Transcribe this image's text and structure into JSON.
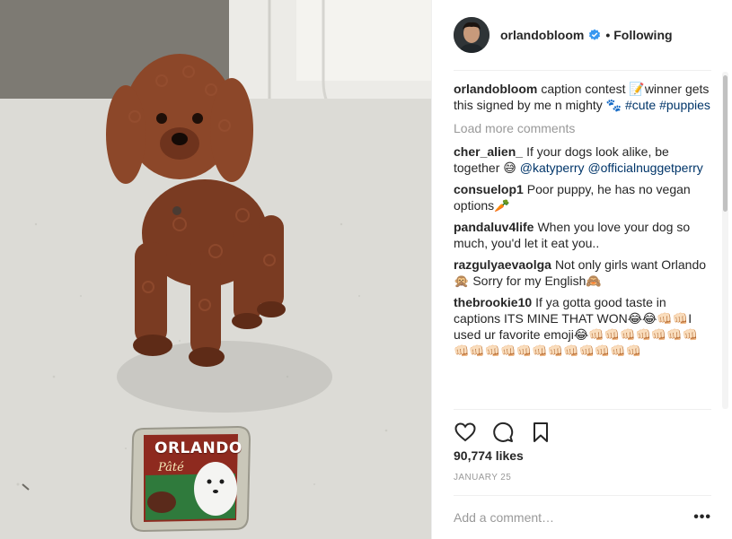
{
  "photo": {
    "can_brand": "ORLANDO",
    "can_sub": "Pâté"
  },
  "header": {
    "username": "orlandobloom",
    "separator": "•",
    "follow_status": "Following"
  },
  "caption": {
    "author": "orlandobloom",
    "text": "caption contest 📝winner gets this signed by me n mighty 🐾",
    "tags": [
      "#cute",
      "#puppies"
    ]
  },
  "load_more": "Load more comments",
  "comments": [
    {
      "author": "cher_alien_",
      "text": "If your dogs look alike, be together 😅",
      "mentions": [
        "@katyperry",
        "@officialnuggetperry"
      ]
    },
    {
      "author": "consuelop1",
      "text": "Poor puppy, he has no vegan options🥕",
      "mentions": []
    },
    {
      "author": "pandaluv4life",
      "text": "When you love your dog so much, you'd let it eat you..",
      "mentions": []
    },
    {
      "author": "razgulyaevaolga",
      "text": "Not only girls want Orlando 🙊 Sorry for my English🙈",
      "mentions": []
    },
    {
      "author": "thebrookie10",
      "text": "If ya gotta good taste in captions ITS MINE THAT WON😂😂👊🏻👊🏻I used ur favorite emoji😂👊🏻👊🏻👊🏻👊🏻👊🏻👊🏻👊🏻👊🏻👊🏻👊🏻👊🏻👊🏻👊🏻👊🏻👊🏻👊🏻👊🏻👊🏻👊🏻",
      "mentions": []
    }
  ],
  "icons": {
    "like": "heart-icon",
    "comment": "comment-icon",
    "save": "bookmark-icon",
    "verified": "verified-badge-icon",
    "more": "more-options-icon"
  },
  "likes": "90,774 likes",
  "date": "JANUARY 25",
  "add_comment": {
    "placeholder": "Add a comment…",
    "value": "",
    "more_label": "•••"
  },
  "colors": {
    "link": "#003569",
    "muted": "#999999",
    "verified": "#3897f0",
    "text": "#262626"
  }
}
